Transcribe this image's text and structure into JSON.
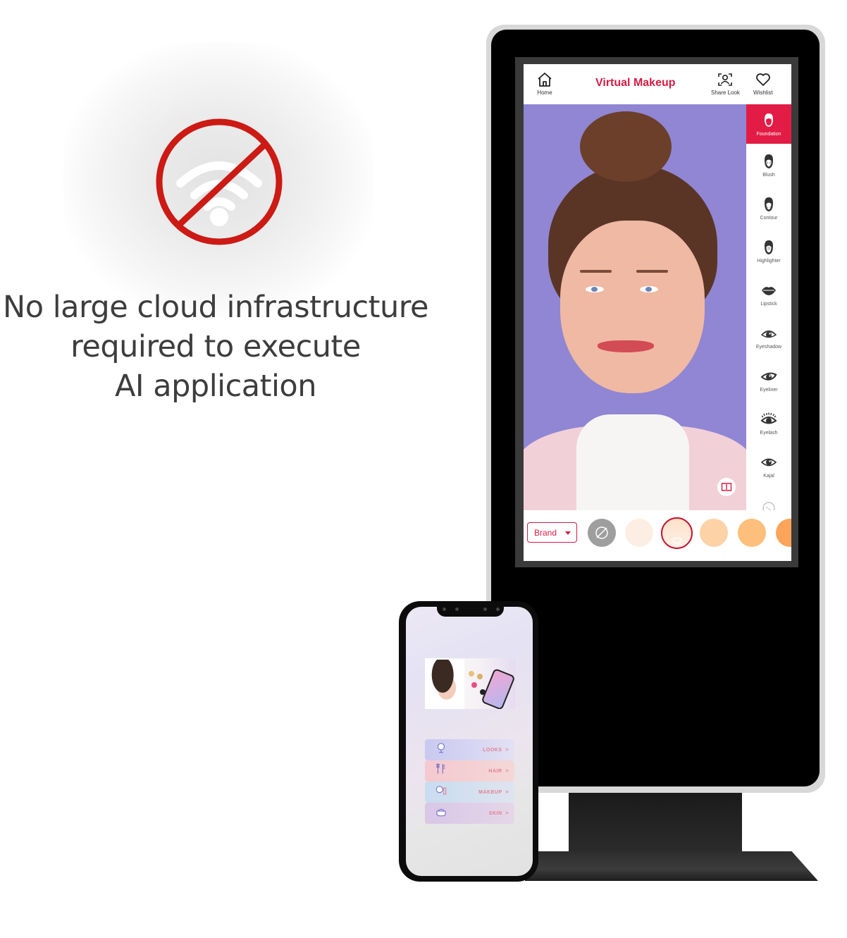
{
  "promo": {
    "icon": "no-wifi-icon",
    "headline_lines": [
      "No large cloud infrastructure",
      "required to execute",
      "AI application"
    ],
    "colors": {
      "prohibit_red": "#cc1a14",
      "text": "#3d3d3d"
    }
  },
  "kiosk_app": {
    "header": {
      "home_label": "Home",
      "title": "Virtual Makeup",
      "share_label": "Share Look",
      "wishlist_label": "Wishlist"
    },
    "categories": [
      {
        "label": "Foundation",
        "icon": "face-hair-icon",
        "active": true
      },
      {
        "label": "Blush",
        "icon": "face-blush-icon",
        "active": false
      },
      {
        "label": "Contour",
        "icon": "face-contour-icon",
        "active": false
      },
      {
        "label": "Highlighter",
        "icon": "face-highlighter-icon",
        "active": false
      },
      {
        "label": "Lipstick",
        "icon": "lips-icon",
        "active": false
      },
      {
        "label": "Eyeshadow",
        "icon": "eyeshadow-icon",
        "active": false
      },
      {
        "label": "Eyeliner",
        "icon": "eyeliner-icon",
        "active": false
      },
      {
        "label": "Eyelash",
        "icon": "eyelash-icon",
        "active": false
      },
      {
        "label": "Kajal",
        "icon": "kajal-eye-icon",
        "active": false
      }
    ],
    "brand_select": {
      "label": "Brand"
    },
    "swatches": [
      {
        "type": "none",
        "color": "#9e9e9e"
      },
      {
        "color": "#fdeee3"
      },
      {
        "color": "#fde0c7",
        "selected": true
      },
      {
        "color": "#fdd2a6"
      },
      {
        "color": "#fdbf7b"
      },
      {
        "color": "#fca45a"
      }
    ],
    "colors": {
      "accent": "#e31c45",
      "title": "#d81b44",
      "photo_bg": "#9086d3"
    }
  },
  "phone_app": {
    "menu": [
      {
        "label": "LOOKS",
        "chevron": ">",
        "icon": "mirror-icon"
      },
      {
        "label": "HAIR",
        "chevron": ">",
        "icon": "brush-comb-icon"
      },
      {
        "label": "MAKEUP",
        "chevron": ">",
        "icon": "compact-lipstick-icon"
      },
      {
        "label": "SKIN",
        "chevron": ">",
        "icon": "cream-jar-icon"
      }
    ]
  }
}
